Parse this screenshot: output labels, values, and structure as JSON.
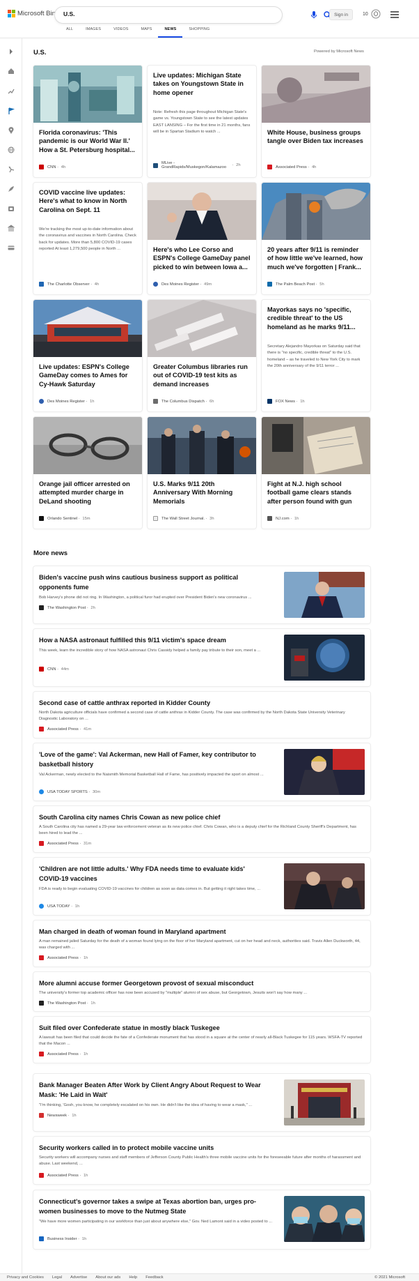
{
  "brand": {
    "name": "Microsoft Bing",
    "colors": [
      "#f25022",
      "#7fba00",
      "#00a4ef",
      "#ffb900"
    ]
  },
  "search": {
    "query": "U.S.",
    "mic_icon": "mic-icon",
    "search_icon": "search-icon"
  },
  "header": {
    "sign_in": "Sign in",
    "rewards_count": "10",
    "rewards_icon": "rewards-icon",
    "menu_icon": "menu-icon"
  },
  "tabs": [
    "ALL",
    "IMAGES",
    "VIDEOS",
    "MAPS",
    "NEWS",
    "SHOPPING"
  ],
  "active_tab": "NEWS",
  "accent_color": "#174ae4",
  "section": {
    "title": "U.S.",
    "powered_by": "Powered by Microsoft News"
  },
  "cards": [
    {
      "headline": "Florida coronavirus: 'This pandemic is our World War II.' How a St. Petersburg hospital...",
      "snippet": "",
      "source": "CNN",
      "time": "4h"
    },
    {
      "headline": "Live updates: Michigan State takes on Youngstown State in home opener",
      "snippet": "Note: Refresh this page throughout Michigan State's game vs. Youngstown State to see the latest updates EAST LANSING – For the first time in 21 months, fans will be in Spartan Stadium to watch ...",
      "source": "MLive - GrandRapids/Muskegon/Kalamazoo",
      "time": "2h"
    },
    {
      "headline": "White House, business groups tangle over Biden tax increases",
      "snippet": "",
      "source": "Associated Press",
      "time": "4h"
    },
    {
      "headline": "COVID vaccine live updates: Here's what to know in North Carolina on Sept. 11",
      "snippet": "We're tracking the most up-to-date information about the coronavirus and vaccines in North Carolina. Check back for updates. More than 5,800 COVID-19 cases reported At least 1,279,500 people in North ...",
      "source": "The Charlotte Observer",
      "time": "4h"
    },
    {
      "headline": "Here's who Lee Corso and ESPN's College GameDay panel picked to win between Iowa a...",
      "snippet": "",
      "source": "Des Moines Register",
      "time": "49m"
    },
    {
      "headline": "20 years after 9/11 is reminder of how little we've learned, how much we've forgotten | Frank...",
      "snippet": "",
      "source": "The Palm Beach Post",
      "time": "5h"
    },
    {
      "headline": "Live updates: ESPN's College GameDay comes to Ames for Cy-Hawk Saturday",
      "snippet": "",
      "source": "Des Moines Register",
      "time": "1h"
    },
    {
      "headline": "Greater Columbus libraries run out of COVID-19 test kits as demand increases",
      "snippet": "",
      "source": "The Columbus Dispatch",
      "time": "6h"
    },
    {
      "headline": "Mayorkas says no 'specific, credible threat' to the US homeland as he marks 9/11...",
      "snippet": "Secretary Alejandro Mayorkas on Saturday said that there is \"no specific, credible threat\" to the U.S. homeland – as he traveled to New York City to mark the 20th anniversary of the 9/11 terror ...",
      "source": "FOX News",
      "time": "1h"
    },
    {
      "headline": "Orange jail officer arrested on attempted murder charge in DeLand shooting",
      "snippet": "",
      "source": "Orlando Sentinel",
      "time": "15m"
    },
    {
      "headline": "U.S. Marks 9/11 20th Anniversary With Morning Memorials",
      "snippet": "",
      "source": "The Wall Street Journal.",
      "time": "3h"
    },
    {
      "headline": "Fight at N.J. high school football game clears stands after person found with gun",
      "snippet": "",
      "source": "NJ.com",
      "time": "1h"
    }
  ],
  "more_news": {
    "title": "More news",
    "items": [
      {
        "headline": "Biden's vaccine push wins cautious business support as political opponents fume",
        "snippet": "Bob Harvey's phone did not ring. In Washington, a political furor had erupted over President Biden's new coronavirus ...",
        "source": "The Washington Post",
        "time": "2h"
      },
      {
        "headline": "How a NASA astronaut fulfilled this 9/11 victim's space dream",
        "snippet": "This week, learn the incredible story of how NASA astronaut Chris Cassidy helped a family pay tribute to their son, meet a ...",
        "source": "CNN",
        "time": "44m"
      },
      {
        "headline": "Second case of cattle anthrax reported in Kidder County",
        "snippet": "North Dakota agriculture officials have confirmed a second case of cattle anthrax in Kidder County. The case was confirmed by the North Dakota State University Veterinary Diagnostic Laboratory on ...",
        "source": "Associated Press",
        "time": "41m"
      },
      {
        "headline": "'Love of the game': Val Ackerman, new Hall of Famer, key contributor to basketball history",
        "snippet": "Val Ackerman, newly elected to the Naismith Memorial Basketball Hall of Fame, has positively impacted the sport on almost ...",
        "source": "USA TODAY SPORTS",
        "time": "30m"
      },
      {
        "headline": "South Carolina city names Chris Cowan as new police chief",
        "snippet": "A South Carolina city has named a 29-year law enforcement veteran as its new police chief. Chris Cowan, who is a deputy chief for the Richland County Sheriff's Department, has been hired to lead the ...",
        "source": "Associated Press",
        "time": "31m"
      },
      {
        "headline": "'Children are not little adults.' Why FDA needs time to evaluate kids' COVID-19 vaccines",
        "snippet": "FDA is ready to begin evaluating COVID-19 vaccines for children as soon as data comes in. But getting it right takes time, ...",
        "source": "USA TODAY",
        "time": "1h"
      },
      {
        "headline": "Man charged in death of woman found in Maryland apartment",
        "snippet": "A man remained jailed Saturday for the death of a woman found lying on the floor of her Maryland apartment, cut on her head and neck, authorities said. Travis Allen Duckworth, 44, was charged with ...",
        "source": "Associated Press",
        "time": "1h"
      },
      {
        "headline": "More alumni accuse former Georgetown provost of sexual misconduct",
        "snippet": "The university's former top academic officer has now been accused by \"multiple\" alumni of sex abuse, but Georgetown, Jesuits won't say how many ...",
        "source": "The Washington Post",
        "time": "1h"
      },
      {
        "headline": "Suit filed over Confederate statue in mostly black Tuskegee",
        "snippet": "A lawsuit has been filed that could decide the fate of a Confederate monument that has stood in a square at the center of nearly all-Black Tuskegee for 115 years. WSFA-TV reported that the Macon ...",
        "source": "Associated Press",
        "time": "1h"
      },
      {
        "headline": "Bank Manager Beaten After Work by Client Angry About Request to Wear Mask: 'He Laid in Wait'",
        "snippet": "\"I'm thinking, 'Gosh, you know, he completely escalated on his own. He didn't like the idea of having to wear a mask,\" ...",
        "source": "Newsweek",
        "time": "1h"
      },
      {
        "headline": "Security workers called in to protect mobile vaccine units",
        "snippet": "Security workers will accompany nurses and staff members of Jefferson County Public Health's three mobile vaccine units for the foreseeable future after months of harassment and abuse. Last weekend, ...",
        "source": "Associated Press",
        "time": "1h"
      },
      {
        "headline": "Connecticut's governor takes a swipe at Texas abortion ban, urges pro-women businesses to move to the Nutmeg State",
        "snippet": "\"We have more women participating in our workforce than just about anywhere else,\" Gov. Ned Lamont said in a video posted to ...",
        "source": "Business Insider",
        "time": "1h"
      }
    ]
  },
  "footer": {
    "links": [
      "Privacy and Cookies",
      "Legal",
      "Advertise",
      "About our ads",
      "Help",
      "Feedback"
    ],
    "copyright": "© 2021 Microsoft"
  }
}
